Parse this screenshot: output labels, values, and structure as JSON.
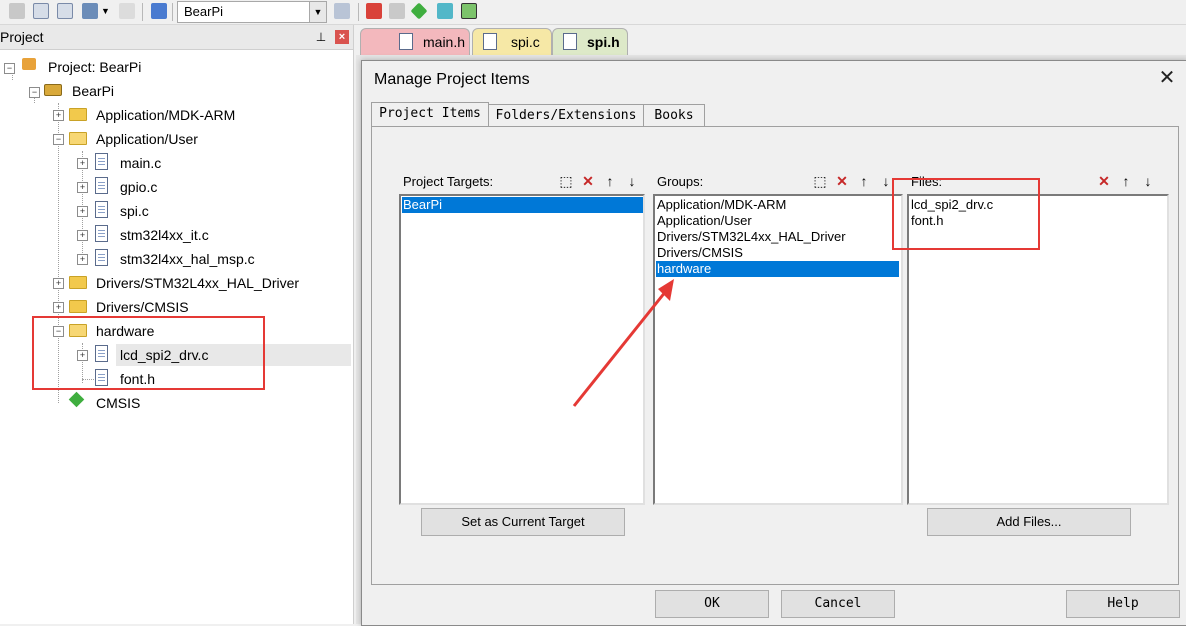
{
  "toolbar": {
    "target_value": "BearPi"
  },
  "project_panel": {
    "title": "Project",
    "tree": {
      "root": "Project: BearPi",
      "target": "BearPi",
      "groups": [
        "Application/MDK-ARM",
        "Application/User",
        "main.c",
        "gpio.c",
        "spi.c",
        "stm32l4xx_it.c",
        "stm32l4xx_hal_msp.c",
        "Drivers/STM32L4xx_HAL_Driver",
        "Drivers/CMSIS",
        "hardware",
        "lcd_spi2_drv.c",
        "font.h",
        "CMSIS"
      ]
    }
  },
  "editor_tabs": [
    "main.h",
    "spi.c",
    "spi.h"
  ],
  "dialog": {
    "title": "Manage Project Items",
    "close": "✕",
    "tabs": [
      "Project Items",
      "Folders/Extensions",
      "Books"
    ],
    "targets": {
      "header": "Project Targets:",
      "items": [
        "BearPi"
      ],
      "selected": "BearPi"
    },
    "groups": {
      "header": "Groups:",
      "items": [
        "Application/MDK-ARM",
        "Application/User",
        "Drivers/STM32L4xx_HAL_Driver",
        "Drivers/CMSIS",
        "hardware"
      ],
      "selected": "hardware"
    },
    "files": {
      "header": "Files:",
      "items": [
        "lcd_spi2_drv.c",
        "font.h"
      ]
    },
    "buttons": {
      "set_target": "Set as Current Target",
      "add_files": "Add Files...",
      "ok": "OK",
      "cancel": "Cancel",
      "help": "Help"
    }
  },
  "colors": {
    "selection": "#0078d7",
    "annotation_red": "#e53935",
    "tab_main_h": "#f3b8bd",
    "tab_spi_c": "#f6e8a6",
    "tab_spi_h": "#dde9c8"
  }
}
